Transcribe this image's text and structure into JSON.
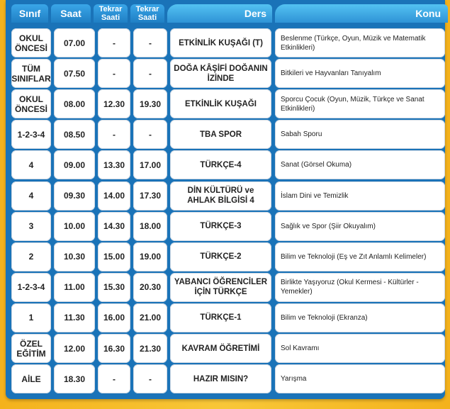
{
  "header": {
    "class_label": "Sınıf",
    "time_label": "Saat",
    "repeat_time_label_1": "Tekrar Saati",
    "repeat_time_label_2": "Tekrar Saati",
    "lesson_label": "Ders",
    "topic_label": "Konu"
  },
  "rows": [
    {
      "class": "OKUL ÖNCESİ",
      "time": "07.00",
      "repeat1": "-",
      "repeat2": "-",
      "lesson": "ETKİNLİK KUŞAĞI (T)",
      "topic": "Beslenme (Türkçe, Oyun, Müzik ve Matematik Etkinlikleri)"
    },
    {
      "class": "TÜM SINIFLAR",
      "time": "07.50",
      "repeat1": "-",
      "repeat2": "-",
      "lesson": "DOĞA KÂŞİFİ DOĞANIN İZİNDE",
      "topic": "Bitkileri ve Hayvanları Tanıyalım"
    },
    {
      "class": "OKUL ÖNCESİ",
      "time": "08.00",
      "repeat1": "12.30",
      "repeat2": "19.30",
      "lesson": "ETKİNLİK KUŞAĞI",
      "topic": "Sporcu Çocuk (Oyun, Müzik, Türkçe ve Sanat Etkinlikleri)"
    },
    {
      "class": "1-2-3-4",
      "time": "08.50",
      "repeat1": "-",
      "repeat2": "-",
      "lesson": "TBA SPOR",
      "topic": "Sabah Sporu"
    },
    {
      "class": "4",
      "time": "09.00",
      "repeat1": "13.30",
      "repeat2": "17.00",
      "lesson": "TÜRKÇE-4",
      "topic": "Sanat (Görsel Okuma)"
    },
    {
      "class": "4",
      "time": "09.30",
      "repeat1": "14.00",
      "repeat2": "17.30",
      "lesson": "DİN KÜLTÜRÜ ve AHLAK BİLGİSİ 4",
      "topic": "İslam Dini ve Temizlik"
    },
    {
      "class": "3",
      "time": "10.00",
      "repeat1": "14.30",
      "repeat2": "18.00",
      "lesson": "TÜRKÇE-3",
      "topic": "Sağlık ve Spor (Şiir Okuyalım)"
    },
    {
      "class": "2",
      "time": "10.30",
      "repeat1": "15.00",
      "repeat2": "19.00",
      "lesson": "TÜRKÇE-2",
      "topic": "Bilim ve Teknoloji (Eş ve Zıt Anlamlı Kelimeler)"
    },
    {
      "class": "1-2-3-4",
      "time": "11.00",
      "repeat1": "15.30",
      "repeat2": "20.30",
      "lesson": "YABANCI ÖĞRENCİLER İÇİN TÜRKÇE",
      "topic": "Birlikte Yaşıyoruz (Okul Kermesi - Kültürler - Yemekler)"
    },
    {
      "class": "1",
      "time": "11.30",
      "repeat1": "16.00",
      "repeat2": "21.00",
      "lesson": "TÜRKÇE-1",
      "topic": "Bilim ve Teknoloji (Ekranza)"
    },
    {
      "class": "ÖZEL EĞİTİM",
      "time": "12.00",
      "repeat1": "16.30",
      "repeat2": "21.30",
      "lesson": "KAVRAM ÖĞRETİMİ",
      "topic": "Sol Kavramı"
    },
    {
      "class": "AİLE",
      "time": "18.30",
      "repeat1": "-",
      "repeat2": "-",
      "lesson": "HAZIR MISIN?",
      "topic": "Yarışma"
    }
  ]
}
